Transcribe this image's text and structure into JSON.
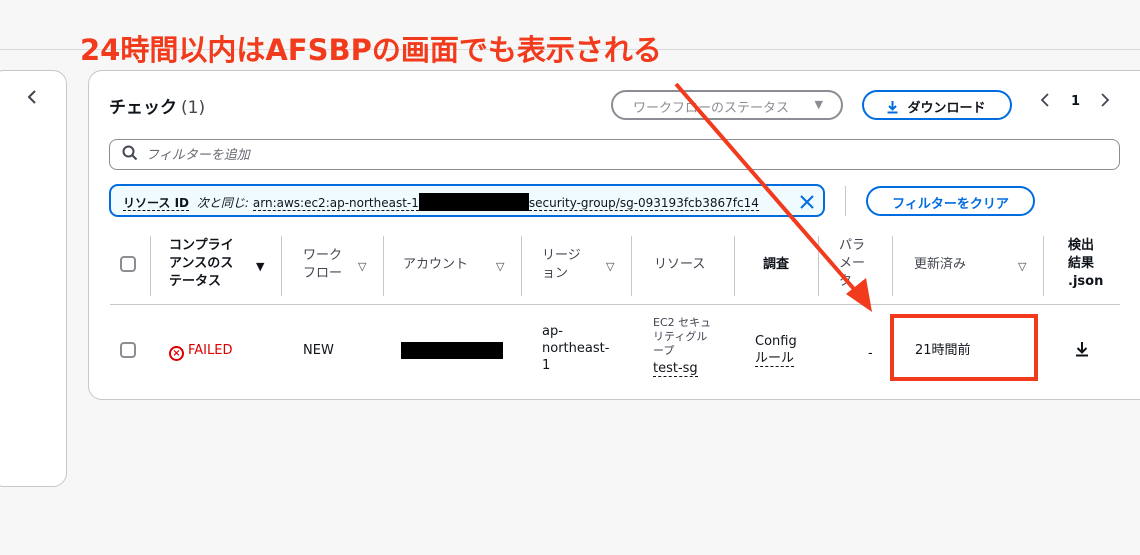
{
  "annotation": {
    "text": "24時間以内はAFSBPの画面でも表示される",
    "color": "#f23a1c"
  },
  "left_panel": {
    "collapse_icon": "chevron-left-icon"
  },
  "checks_panel": {
    "title": "チェック",
    "count": "(1)",
    "workflow_status_select": {
      "placeholder": "ワークフローのステータス"
    },
    "download_button": {
      "label": "ダウンロード",
      "icon": "download-icon"
    },
    "pagination": {
      "current_page": "1"
    },
    "search": {
      "placeholder": "フィルターを追加"
    },
    "filter_token": {
      "key": "リソース ID",
      "operator": "次と同じ:",
      "value_prefix": "arn:aws:ec2:ap-northeast-1",
      "value_suffix": "security-group/sg-093193fcb3867fc14"
    },
    "clear_filters_button": "フィルターをクリア"
  },
  "table": {
    "columns": {
      "compliance_status": [
        "コンプライ",
        "アンスのス",
        "テータス"
      ],
      "workflow": [
        "ワーク",
        "フロー"
      ],
      "account": "アカウント",
      "region": [
        "リージ",
        "ョン"
      ],
      "resource": "リソース",
      "investigation": "調査",
      "parameters": [
        "パラ",
        "メー",
        "タ"
      ],
      "updated": "更新済み",
      "result_json": [
        "検出",
        "結果",
        ".json"
      ]
    },
    "rows": [
      {
        "compliance_status": "FAILED",
        "workflow": "NEW",
        "account": "",
        "region": [
          "ap-",
          "northeast-",
          "1"
        ],
        "resource_type": [
          "EC2 セキュ",
          "リティグル",
          "ープ"
        ],
        "resource_name": "test-sg",
        "investigation": [
          "Config",
          "ルール"
        ],
        "parameters": "-",
        "updated": "21時間前"
      }
    ]
  }
}
